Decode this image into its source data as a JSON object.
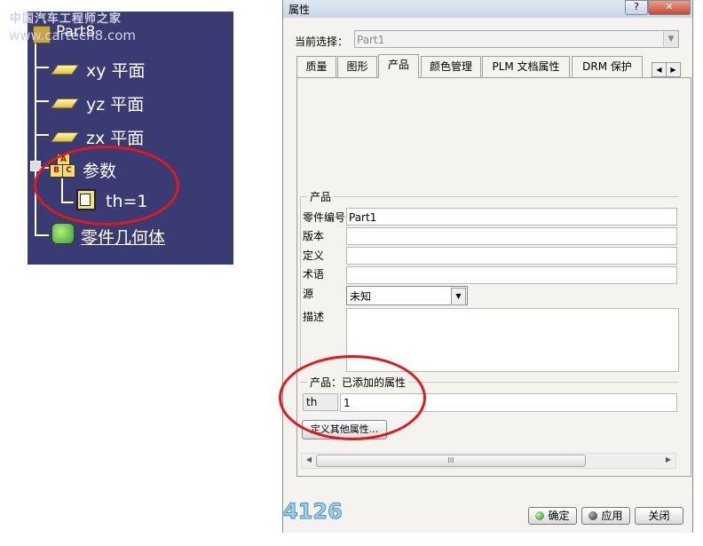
{
  "watermark": {
    "line1": "中国汽车工程师之家",
    "line2": "www.cartech8.com"
  },
  "tree": {
    "root": "Part8",
    "items": [
      {
        "label": "xy 平面"
      },
      {
        "label": "yz 平面"
      },
      {
        "label": "zx 平面"
      },
      {
        "label": "参数"
      },
      {
        "label": "th=1"
      },
      {
        "label": "零件几何体"
      }
    ],
    "param_icon_letters": [
      "A",
      "B",
      "C"
    ]
  },
  "dialog": {
    "title": "属性",
    "help_label": "?",
    "close_label": "✕",
    "current_selection_label": "当前选择：",
    "current_selection_value": "Part1",
    "tabs": [
      {
        "label": "质量"
      },
      {
        "label": "图形"
      },
      {
        "label": "产品",
        "active": true
      },
      {
        "label": "颜色管理"
      },
      {
        "label": "PLM 文档属性"
      },
      {
        "label": "DRM 保护"
      }
    ],
    "product_group": {
      "legend": "产品",
      "part_number_label": "零件编号",
      "part_number_value": "Part1",
      "revision_label": "版本",
      "revision_value": "",
      "definition_label": "定义",
      "definition_value": "",
      "nomenclature_label": "术语",
      "nomenclature_value": "",
      "source_label": "源",
      "source_value": "未知",
      "description_label": "描述",
      "description_value": ""
    },
    "added_props_group": {
      "legend": "产品：已添加的属性",
      "property_name": "th",
      "property_value": "1",
      "define_button": "定义其他属性..."
    },
    "scroll_thumb_grip": "III",
    "buttons": {
      "ok": "确定",
      "apply": "应用",
      "close": "关闭"
    },
    "corner_number": "4126"
  },
  "colors": {
    "tree_bg": "#3b3b73",
    "annotation_red": "#e01919",
    "dialog_bg": "#f4f3ef"
  }
}
